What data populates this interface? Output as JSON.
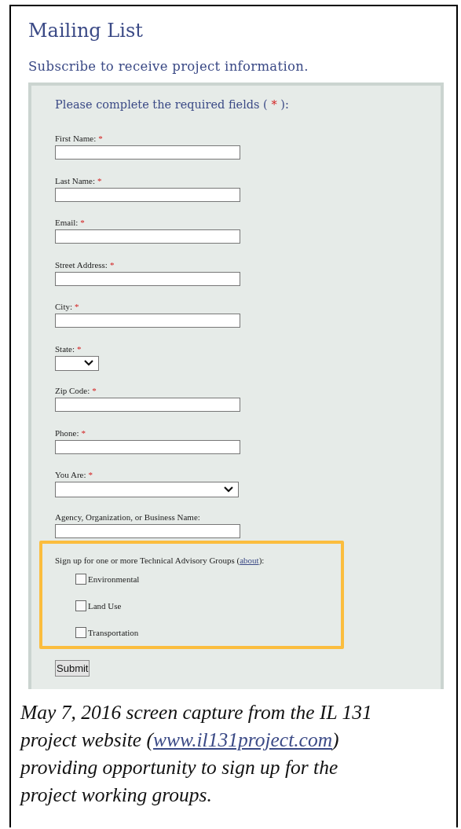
{
  "title": "Mailing List",
  "subtitle": "Subscribe to receive project information.",
  "form": {
    "intro": {
      "text": "Please complete the required fields (",
      "mark": "*",
      "end": "):"
    },
    "required_mark": "*",
    "fields": [
      {
        "label": "First Name:",
        "required": true,
        "kind": "text"
      },
      {
        "label": "Last Name:",
        "required": true,
        "kind": "text"
      },
      {
        "label": "Email:",
        "required": true,
        "kind": "text"
      },
      {
        "label": "Street Address:",
        "required": true,
        "kind": "text"
      },
      {
        "label": "City:",
        "required": true,
        "kind": "text"
      },
      {
        "label": "State:",
        "required": true,
        "kind": "select-short"
      },
      {
        "label": "Zip Code:",
        "required": true,
        "kind": "text"
      },
      {
        "label": "Phone:",
        "required": true,
        "kind": "text"
      },
      {
        "label": "You Are:",
        "required": true,
        "kind": "select-wide"
      },
      {
        "label": "Agency, Organization, or Business Name:",
        "required": false,
        "kind": "text"
      }
    ],
    "groups": {
      "text": "Sign up for one or more Technical Advisory Groups (",
      "link": "about",
      "end": "):",
      "options": [
        {
          "label": "Environmental",
          "checked": false
        },
        {
          "label": "Land Use",
          "checked": false
        },
        {
          "label": "Transportation",
          "checked": false
        }
      ]
    },
    "submit": "Submit"
  },
  "caption": {
    "before": "May 7, 2016 screen capture from the IL 131 project website (",
    "link": "www.il131project.com",
    "after": ") providing opportunity to sign up for the project working groups."
  }
}
